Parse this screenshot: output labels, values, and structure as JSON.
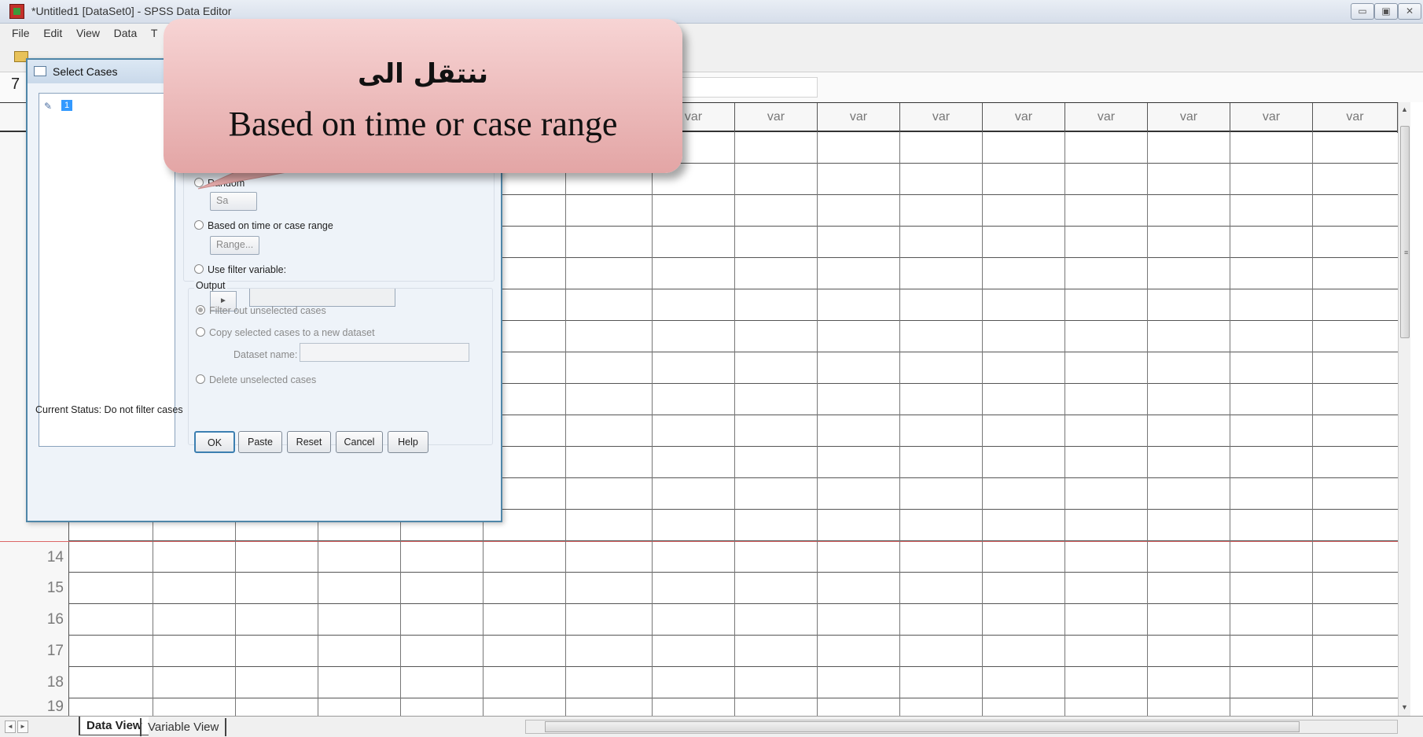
{
  "window": {
    "title": "*Untitled1 [DataSet0] - SPSS Data Editor",
    "controls": [
      "minimize",
      "restore",
      "close"
    ]
  },
  "menu": [
    "File",
    "Edit",
    "View",
    "Data",
    "T"
  ],
  "cell_bar": {
    "cell_ref": "7"
  },
  "grid": {
    "column_header": "var",
    "rows": [
      "14",
      "15",
      "16",
      "17",
      "18",
      "19"
    ]
  },
  "tabs": {
    "data_view": "Data View",
    "variable_view": "Variable View"
  },
  "dialog": {
    "title": "Select Cases",
    "variable": "1",
    "options": {
      "random_label": "Random",
      "sample_button": "Sa",
      "based_on_time_label": "Based on time or case range",
      "range_button": "Range...",
      "use_filter_label": "Use filter variable:"
    },
    "output": {
      "label": "Output",
      "filter_out": "Filter out unselected cases",
      "copy_selected": "Copy selected cases to a new dataset",
      "dataset_name_label": "Dataset name:",
      "delete_unselected": "Delete unselected cases"
    },
    "status": "Current Status: Do not filter cases",
    "buttons": {
      "ok": "OK",
      "paste": "Paste",
      "reset": "Reset",
      "cancel": "Cancel",
      "help": "Help"
    }
  },
  "callout": {
    "arabic": "ننتقل الى",
    "english": "Based on time or case range",
    "colors": {
      "fill": "#ecb8b8",
      "text": "#111111"
    }
  }
}
